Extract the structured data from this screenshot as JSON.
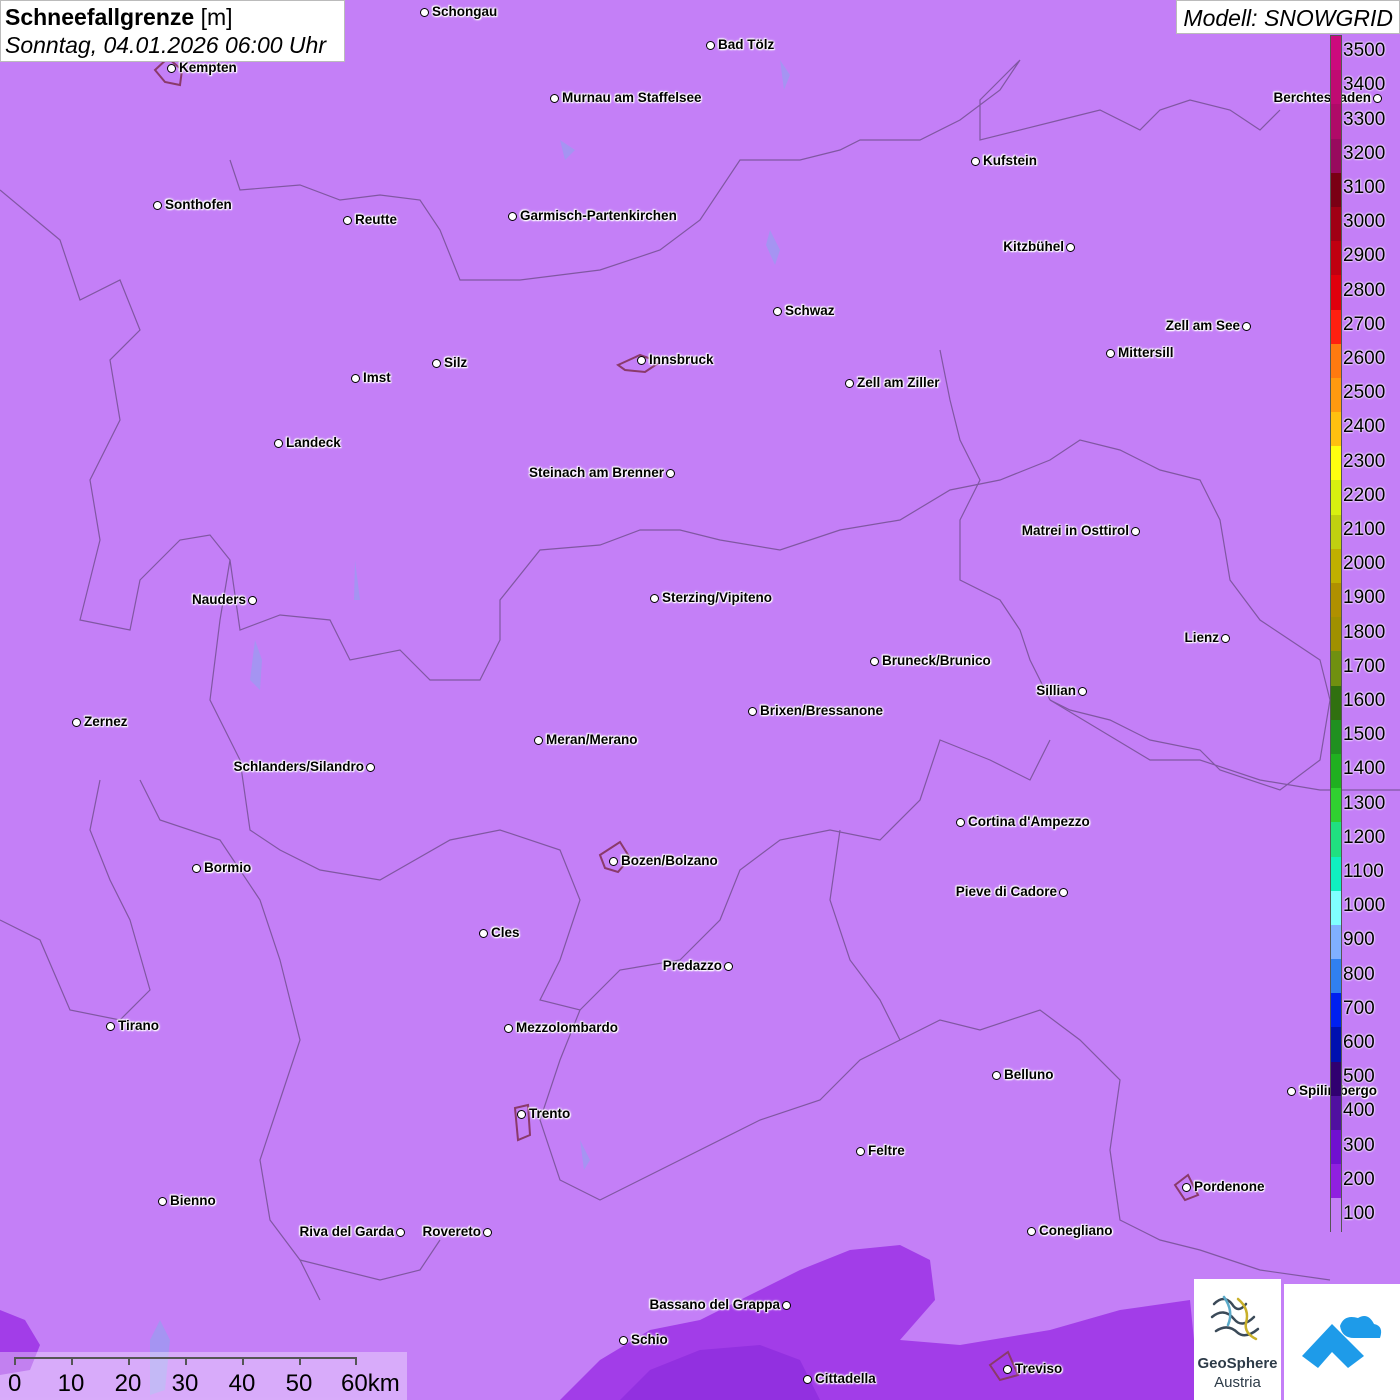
{
  "title": {
    "bold": "Schneefallgrenze",
    "unit": "[m]",
    "date": "Sonntag, 04.01.2026 06:00 Uhr"
  },
  "model": "Modell: SNOWGRID",
  "colors": {
    "background": "#c47ff7",
    "low_region": "#a23de8",
    "lowest_region": "#8a22d8"
  },
  "colorbar": {
    "labels": [
      "3500",
      "3400",
      "3300",
      "3200",
      "3100",
      "3000",
      "2900",
      "2800",
      "2700",
      "2600",
      "2500",
      "2400",
      "2300",
      "2200",
      "2100",
      "2000",
      "1900",
      "1800",
      "1700",
      "1600",
      "1500",
      "1400",
      "1300",
      "1200",
      "1100",
      "1000",
      "900",
      "800",
      "700",
      "600",
      "500",
      "400",
      "300",
      "200",
      "100"
    ],
    "colors": [
      "#cc0a7d",
      "#c00a72",
      "#b00a68",
      "#980a5e",
      "#7a0014",
      "#a00014",
      "#c00010",
      "#e0000c",
      "#ff2010",
      "#ff7a10",
      "#ff9a10",
      "#ffc010",
      "#ffff10",
      "#d8f010",
      "#c0d010",
      "#c0b000",
      "#b09000",
      "#a09000",
      "#709010",
      "#307010",
      "#209020",
      "#20b020",
      "#30d030",
      "#20e080",
      "#10f0c0",
      "#80ffff",
      "#80b0ff",
      "#3080f0",
      "#0020f0",
      "#0010b0",
      "#300070",
      "#5010a0",
      "#7010d0",
      "#9020e0",
      "#c47ff7"
    ]
  },
  "scale": {
    "labels": [
      "0",
      "10",
      "20",
      "30",
      "40",
      "50",
      "60km"
    ]
  },
  "cities": [
    {
      "name": "Schongau",
      "side": "right"
    },
    {
      "name": "Bad Tölz",
      "side": "right"
    },
    {
      "name": "Kempten",
      "side": "right"
    },
    {
      "name": "Murnau am Staffelsee",
      "side": "right"
    },
    {
      "name": "Berchtesgaden",
      "side": "left"
    },
    {
      "name": "Kufstein",
      "side": "right"
    },
    {
      "name": "Sonthofen",
      "side": "right"
    },
    {
      "name": "Reutte",
      "side": "right"
    },
    {
      "name": "Garmisch-Partenkirchen",
      "side": "right"
    },
    {
      "name": "Kitzbühel",
      "side": "left"
    },
    {
      "name": "Schwaz",
      "side": "right"
    },
    {
      "name": "Zell am See",
      "side": "left"
    },
    {
      "name": "Innsbruck",
      "side": "right"
    },
    {
      "name": "Mittersill",
      "side": "right"
    },
    {
      "name": "Silz",
      "side": "right"
    },
    {
      "name": "Imst",
      "side": "right"
    },
    {
      "name": "Zell am Ziller",
      "side": "right"
    },
    {
      "name": "Landeck",
      "side": "right"
    },
    {
      "name": "Steinach am Brenner",
      "side": "left"
    },
    {
      "name": "Matrei in Osttirol",
      "side": "left"
    },
    {
      "name": "Nauders",
      "side": "left"
    },
    {
      "name": "Sterzing/Vipiteno",
      "side": "right"
    },
    {
      "name": "Lienz",
      "side": "left"
    },
    {
      "name": "Bruneck/Brunico",
      "side": "right"
    },
    {
      "name": "Sillian",
      "side": "left"
    },
    {
      "name": "Brixen/Bressanone",
      "side": "right"
    },
    {
      "name": "Zernez",
      "side": "right"
    },
    {
      "name": "Meran/Merano",
      "side": "right"
    },
    {
      "name": "Schlanders/Silandro",
      "side": "left"
    },
    {
      "name": "Cortina d'Ampezzo",
      "side": "right"
    },
    {
      "name": "Bozen/Bolzano",
      "side": "right"
    },
    {
      "name": "Bormio",
      "side": "right"
    },
    {
      "name": "Pieve di Cadore",
      "side": "left"
    },
    {
      "name": "Cles",
      "side": "right"
    },
    {
      "name": "Predazzo",
      "side": "left"
    },
    {
      "name": "Tirano",
      "side": "right"
    },
    {
      "name": "Mezzolombardo",
      "side": "right"
    },
    {
      "name": "Belluno",
      "side": "right"
    },
    {
      "name": "Spilimbergo",
      "side": "right"
    },
    {
      "name": "Trento",
      "side": "right"
    },
    {
      "name": "Feltre",
      "side": "right"
    },
    {
      "name": "Pordenone",
      "side": "right"
    },
    {
      "name": "Bienno",
      "side": "right"
    },
    {
      "name": "Riva del Garda",
      "side": "left"
    },
    {
      "name": "Rovereto",
      "side": "left"
    },
    {
      "name": "Conegliano",
      "side": "right"
    },
    {
      "name": "Bassano del Grappa",
      "side": "left"
    },
    {
      "name": "Schio",
      "side": "right"
    },
    {
      "name": "Cittadella",
      "side": "right"
    },
    {
      "name": "Treviso",
      "side": "right"
    }
  ],
  "logos": {
    "geosphere_line1": "GeoSphere",
    "geosphere_line2": "Austria"
  }
}
